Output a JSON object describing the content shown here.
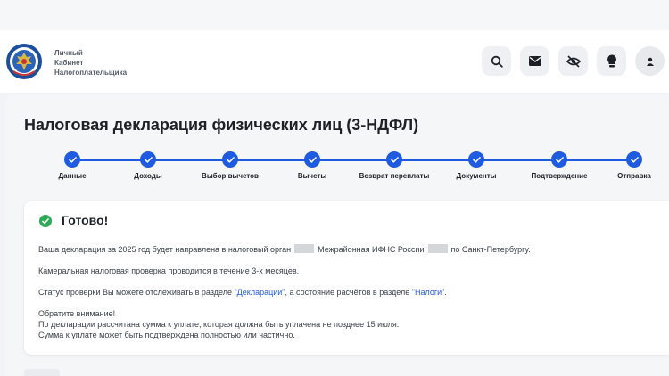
{
  "brand": {
    "line1": "Личный",
    "line2": "Кабинет",
    "line3": "Налогоплательщика"
  },
  "header_icons": [
    "search-icon",
    "mail-icon",
    "eye-off-icon",
    "lightbulb-icon",
    "user-icon"
  ],
  "page": {
    "title": "Налоговая декларация физических лиц (3-НДФЛ)"
  },
  "stepper": {
    "steps": [
      "Данные",
      "Доходы",
      "Выбор вычетов",
      "Вычеты",
      "Возврат переплаты",
      "Документы",
      "Подтверждение",
      "Отправка"
    ],
    "completed": 8
  },
  "result": {
    "title": "Готово!",
    "line1_a": "Ваша декларация за 2025 год будет направлена в налоговый орган",
    "line1_b": "Межрайонная ИФНС России",
    "line1_c": "по Санкт-Петербургу.",
    "line2": "Камеральная налоговая проверка проводится в течение 3-х месяцев.",
    "line3_a": "Статус проверки Вы можете отслеживать в разделе ",
    "line3_link1": "\"Декларации\"",
    "line3_b": ", а состояние расчётов в разделе ",
    "line3_link2": "\"Налоги\"",
    "line3_c": ".",
    "note1": "Обратите внимание!",
    "note2": "По декларации рассчитана сумма к уплате, которая должна быть уплачена не позднее 15 июля.",
    "note3": "Сумма к уплате может быть подтверждена полностью или частично."
  },
  "colors": {
    "accent": "#1f5be0",
    "success": "#2eaa57",
    "panel": "#f5f6f8",
    "text": "#1d2127"
  }
}
